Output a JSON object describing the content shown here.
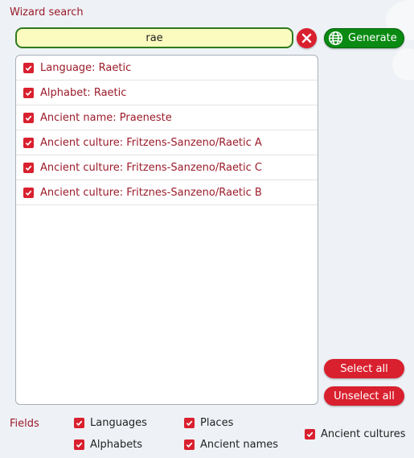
{
  "panel": {
    "title": "Wizard search"
  },
  "search": {
    "value": "rae"
  },
  "toolbar": {
    "generate_label": "Generate"
  },
  "results": [
    {
      "label": "Language: Raetic",
      "checked": true
    },
    {
      "label": "Alphabet: Raetic",
      "checked": true
    },
    {
      "label": "Ancient name: Praeneste",
      "checked": true
    },
    {
      "label": "Ancient culture: Fritzens-Sanzeno/Raetic A",
      "checked": true
    },
    {
      "label": "Ancient culture: Fritzens-Sanzeno/Raetic C",
      "checked": true
    },
    {
      "label": "Ancient culture: Fritznes-Sanzeno/Raetic B",
      "checked": true
    }
  ],
  "actions": {
    "select_all": "Select all",
    "unselect_all": "Unselect all"
  },
  "fields": {
    "label": "Fields",
    "options": [
      {
        "label": "Languages",
        "checked": true
      },
      {
        "label": "Places",
        "checked": true
      },
      {
        "label": "Alphabets",
        "checked": true
      },
      {
        "label": "Ancient names",
        "checked": true
      },
      {
        "label": "Ancient cultures",
        "checked": true
      }
    ]
  },
  "colors": {
    "accent": "#d9202e",
    "generate": "#0a8a12",
    "title_text": "#9b1b2a",
    "search_bg": "#fbfbbf"
  },
  "icons": {
    "clear": "close-icon",
    "generate": "globe-icon",
    "checkbox": "checkmark-icon"
  }
}
